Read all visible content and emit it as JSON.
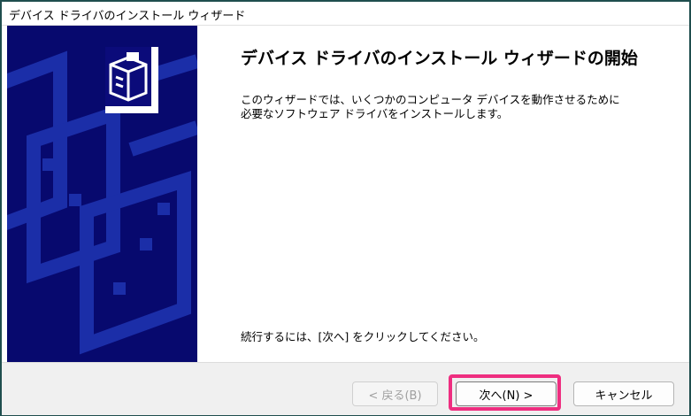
{
  "window": {
    "title": "デバイス ドライバのインストール ウィザード"
  },
  "main": {
    "heading": "デバイス ドライバのインストール ウィザードの開始",
    "description_line1": "このウィザードでは、いくつかのコンピュータ デバイスを動作させるために",
    "description_line2": "必要なソフトウェア ドライバをインストールします。",
    "continue_text": "続行するには、[次へ] をクリックしてください。"
  },
  "buttons": {
    "back_label": "< 戻る(B)",
    "next_label": "次へ(N) >",
    "cancel_label": "キャンセル"
  },
  "colors": {
    "banner": "#07096e",
    "highlight": "#ee2e80"
  },
  "icons": {
    "banner_icon": "hardware-install-icon"
  }
}
